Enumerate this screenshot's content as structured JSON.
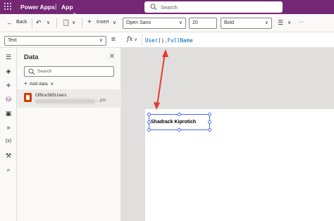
{
  "titlebar": {
    "app_name": "Power Apps",
    "separator": "|",
    "app_title": "App",
    "search_placeholder": "Search"
  },
  "toolbar": {
    "back_label": "Back",
    "insert_label": "Insert",
    "font_value": "Open Sans",
    "size_value": "20",
    "weight_value": "Bold",
    "more_label": "···"
  },
  "formulabar": {
    "property": "Text",
    "equals": "=",
    "fx_label": "fx",
    "formula_fn": "User",
    "formula_paren": "()",
    "formula_prop": ".FullName"
  },
  "data_panel": {
    "title": "Data",
    "search_placeholder": "Search",
    "add_data_label": "Add data",
    "items": [
      {
        "name": "Office365Users",
        "suffix": "...pm"
      }
    ]
  },
  "canvas": {
    "label_text": "Shadrack Kiprotich"
  },
  "colors": {
    "brand": "#742774",
    "selection": "#4f6bed",
    "annotation_arrow": "#e53935"
  }
}
